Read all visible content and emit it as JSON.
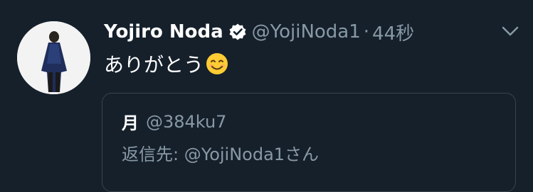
{
  "tweet": {
    "display_name": "Yojiro Noda",
    "handle": "@YojiNoda1",
    "separator": "·",
    "time": "44秒",
    "text": "ありがとう",
    "emoji": "smiling-face-icon"
  },
  "quote": {
    "name": "月",
    "handle": "@384ku7",
    "reply_prefix": "返信先: ",
    "reply_to": "@YojiNoda1さん"
  },
  "colors": {
    "background": "#15202b",
    "primary_text": "#ffffff",
    "secondary_text": "#8899a6",
    "border": "#38444d"
  },
  "icons": [
    "verified-badge-icon",
    "chevron-down-icon",
    "smiling-face-icon"
  ]
}
